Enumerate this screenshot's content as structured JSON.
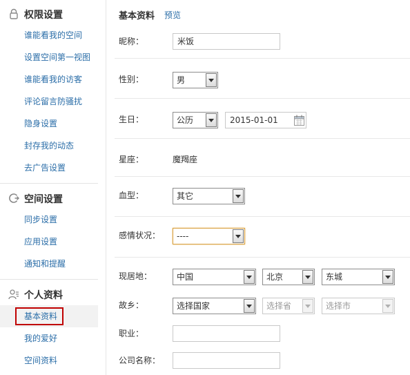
{
  "sidebar": {
    "sections": [
      {
        "title": "权限设置",
        "icon": "lock-icon",
        "items": [
          "谁能看我的空间",
          "设置空间第一视图",
          "谁能看我的访客",
          "评论留言防骚扰",
          "隐身设置",
          "封存我的动态",
          "去广告设置"
        ]
      },
      {
        "title": "空间设置",
        "icon": "space-settings-icon",
        "items": [
          "同步设置",
          "应用设置",
          "通知和提醒"
        ]
      },
      {
        "title": "个人资料",
        "icon": "user-profile-icon",
        "items": [
          "基本资料",
          "我的爱好",
          "空间资料"
        ],
        "active_item": "基本资料"
      }
    ],
    "highlight_color": "#c00000"
  },
  "main": {
    "title": "基本资料",
    "preview_label": "预览",
    "fields": {
      "nickname": {
        "label": "昵称：",
        "value": "米饭"
      },
      "gender": {
        "label": "性别：",
        "value": "男"
      },
      "birthday": {
        "label": "生日：",
        "calendar_type": "公历",
        "date": "2015-01-01"
      },
      "zodiac": {
        "label": "星座：",
        "value": "魔羯座"
      },
      "blood_type": {
        "label": "血型：",
        "value": "其它"
      },
      "relationship": {
        "label": "感情状况：",
        "value": "----"
      },
      "current_location": {
        "label": "现居地：",
        "country": "中国",
        "province": "北京",
        "city": "东城"
      },
      "hometown": {
        "label": "故乡：",
        "country": "选择国家",
        "province": "选择省",
        "city": "选择市"
      },
      "occupation": {
        "label": "职业：",
        "value": ""
      },
      "company": {
        "label": "公司名称：",
        "value": ""
      }
    }
  },
  "colors": {
    "link": "#2b6ea8",
    "text": "#333333",
    "focus_border": "#d8a040"
  }
}
